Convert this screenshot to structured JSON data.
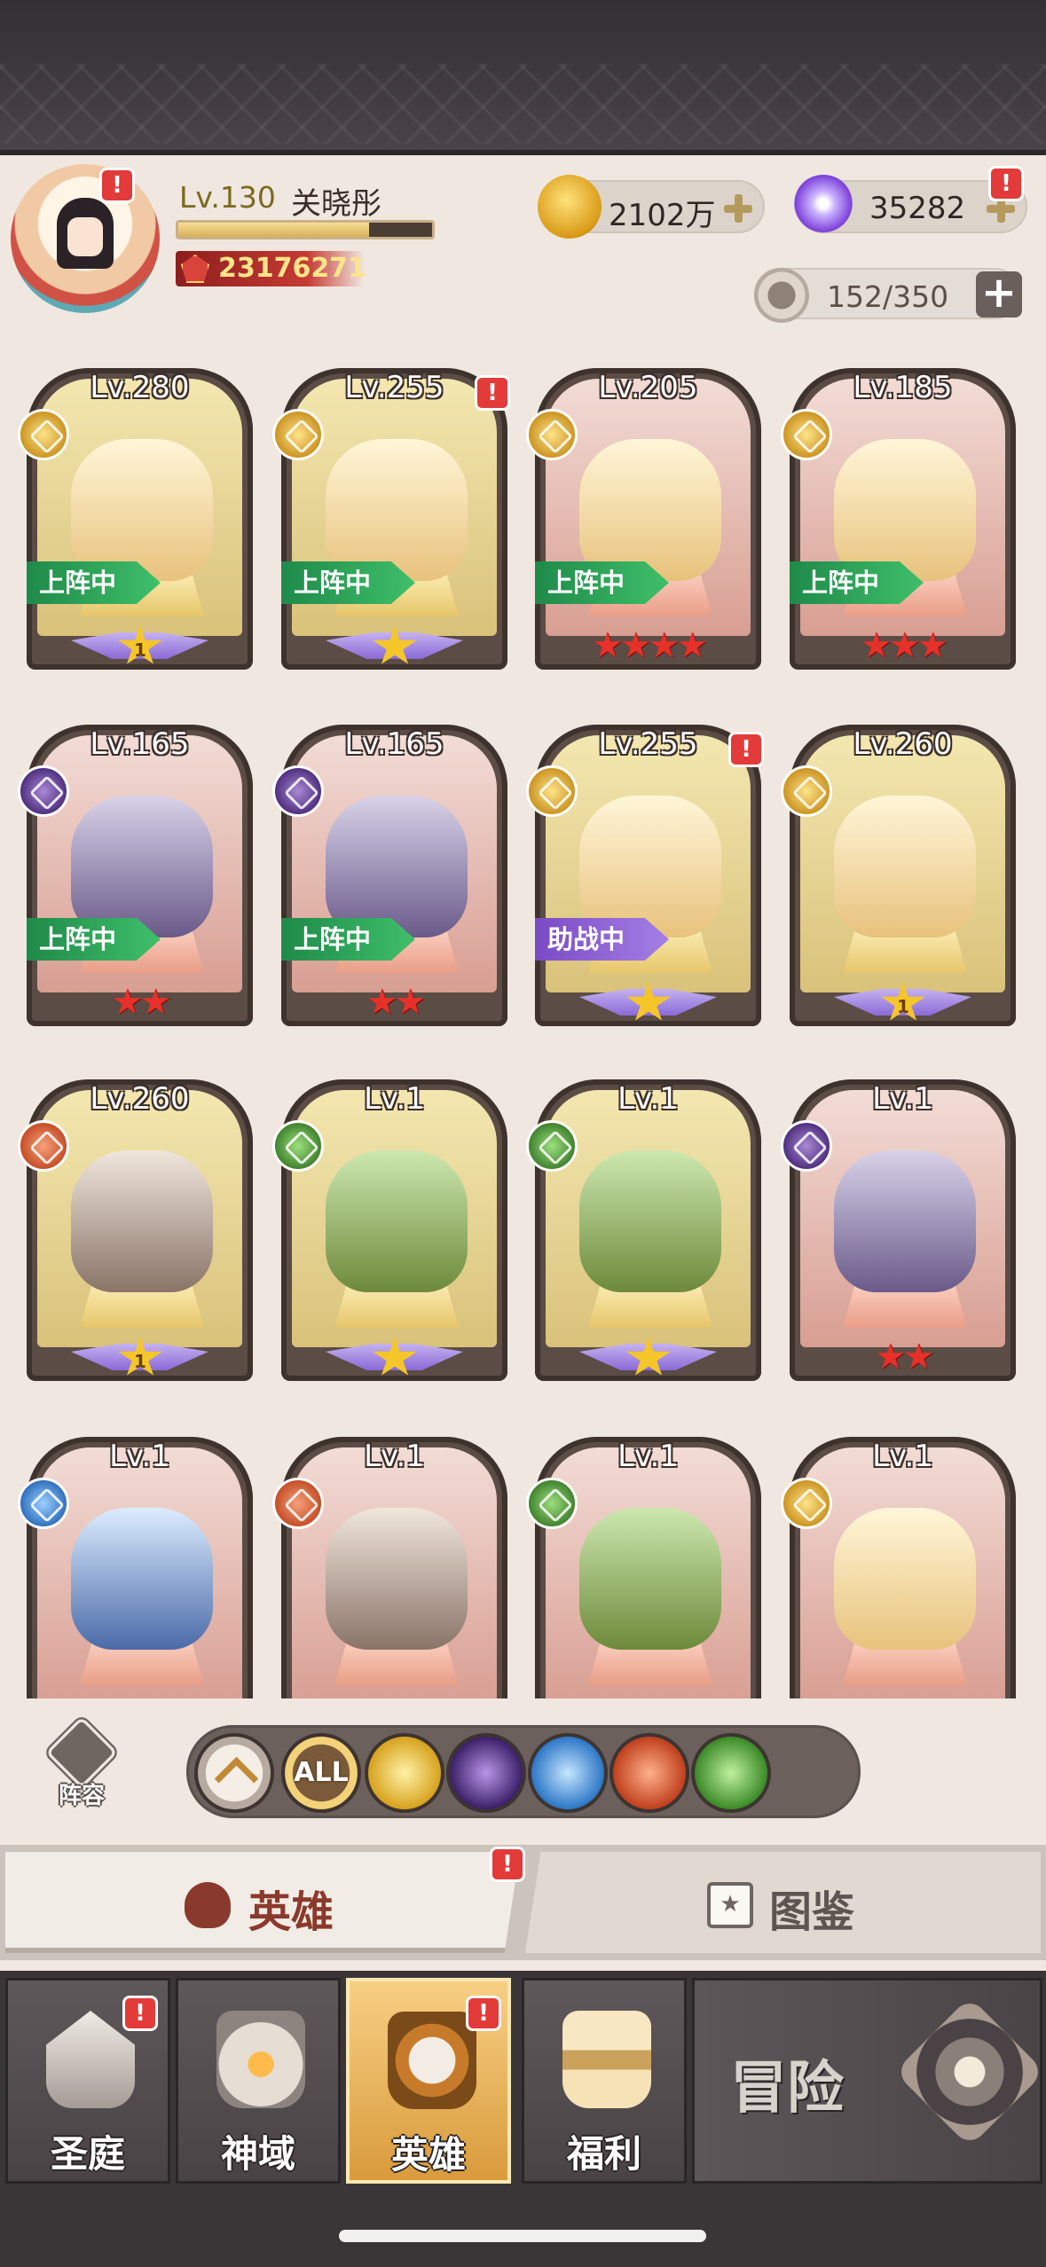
{
  "player": {
    "level": "Lv.130",
    "name": "关晓彤",
    "exp_fraction": 0.75,
    "power": "23176271"
  },
  "currency": {
    "gold": "2102万",
    "diamonds": "35282"
  },
  "capacity": {
    "value": "152/350",
    "plus": "+"
  },
  "heroes": [
    {
      "level": "Lv.280",
      "faction": "light",
      "status": "上阵中",
      "stars_type": "wing-gold",
      "star_number": "1",
      "notify": false
    },
    {
      "level": "Lv.255",
      "faction": "light",
      "status": "上阵中",
      "stars_type": "wing-gold",
      "star_number": "",
      "notify": true
    },
    {
      "level": "Lv.205",
      "faction": "light",
      "status": "上阵中",
      "stars_type": "red",
      "stars": "★★★★",
      "notify": false
    },
    {
      "level": "Lv.185",
      "faction": "light",
      "status": "上阵中",
      "stars_type": "red",
      "stars": "★★★",
      "notify": false
    },
    {
      "level": "Lv.165",
      "faction": "dark",
      "status": "上阵中",
      "stars_type": "red",
      "stars": "★★",
      "notify": false
    },
    {
      "level": "Lv.165",
      "faction": "dark",
      "status": "上阵中",
      "stars_type": "red",
      "stars": "★★",
      "notify": false
    },
    {
      "level": "Lv.255",
      "faction": "light",
      "status": "助战中",
      "stars_type": "wing-gold",
      "star_number": "",
      "notify": true
    },
    {
      "level": "Lv.260",
      "faction": "light",
      "status": "",
      "stars_type": "wing-gold",
      "star_number": "1",
      "notify": false
    },
    {
      "level": "Lv.260",
      "faction": "beast",
      "status": "",
      "stars_type": "wing-gold",
      "star_number": "1",
      "notify": false
    },
    {
      "level": "Lv.1",
      "faction": "nature",
      "status": "",
      "stars_type": "wing-gold",
      "star_number": "",
      "notify": false
    },
    {
      "level": "Lv.1",
      "faction": "nature",
      "status": "",
      "stars_type": "wing-gold",
      "star_number": "",
      "notify": false
    },
    {
      "level": "Lv.1",
      "faction": "dark",
      "status": "",
      "stars_type": "red",
      "stars": "★★",
      "notify": false
    },
    {
      "level": "Lv.1",
      "faction": "holy",
      "status": "",
      "stars_type": "none",
      "notify": false
    },
    {
      "level": "Lv.1",
      "faction": "beast",
      "status": "",
      "stars_type": "none",
      "notify": false
    },
    {
      "level": "Lv.1",
      "faction": "nature",
      "status": "",
      "stars_type": "none",
      "notify": false
    },
    {
      "level": "Lv.1",
      "faction": "light",
      "status": "",
      "stars_type": "none",
      "notify": false
    }
  ],
  "filter": {
    "lineup_label": "阵容",
    "all_label": "ALL",
    "factions": [
      "light-faction-icon",
      "dark-faction-icon",
      "holy-faction-icon",
      "beast-faction-icon",
      "nature-faction-icon"
    ]
  },
  "tabs": {
    "hero": "英雄",
    "guide": "图鉴",
    "guide_icon": "★"
  },
  "nav": {
    "court": "圣庭",
    "domain": "神域",
    "hero": "英雄",
    "welfare": "福利",
    "adventure": "冒险"
  },
  "badge": "!",
  "colors": {
    "active_tab": "#d99b3c",
    "status_green": "#1f8a4a",
    "status_purple": "#7a4bc4",
    "notify_red": "#e33a3a"
  }
}
